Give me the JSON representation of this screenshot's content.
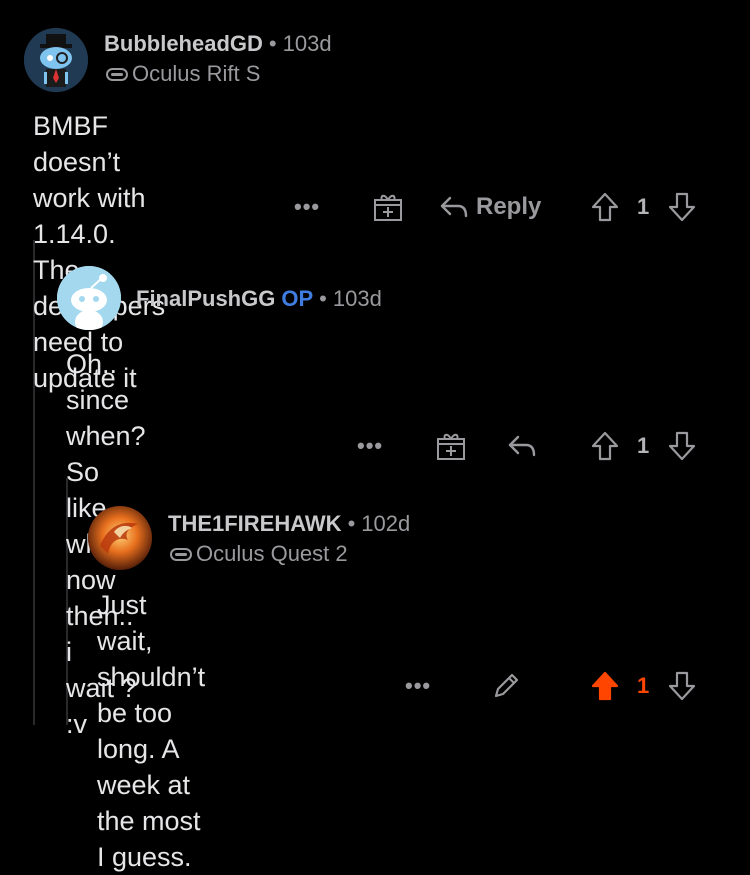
{
  "comments": [
    {
      "username": "BubbleheadGD",
      "age": "103d",
      "flair": "Oculus Rift S",
      "body_lines": [
        "BMBF doesn’t work with 1.14.0. The developers",
        "need to update it"
      ],
      "actions": {
        "more": "•••",
        "reply": "Reply",
        "score": "1",
        "upvoted": false
      }
    },
    {
      "username": "FinalPushGG",
      "op_badge": "OP",
      "age": "103d",
      "body_lines": [
        "Oh.. since when? So like what now then.. i",
        "wait ? :v"
      ],
      "actions": {
        "more": "•••",
        "score": "1",
        "upvoted": false
      }
    },
    {
      "username": "THE1FIREHAWK",
      "age": "102d",
      "flair": "Oculus Quest 2",
      "body_lines": [
        "Just wait, shouldn’t be too long. A week at",
        "the most I guess."
      ],
      "actions": {
        "more": "•••",
        "score": "1",
        "upvoted": true
      }
    }
  ],
  "meta": {
    "separator": "•"
  },
  "colors": {
    "background": "#000000",
    "op": "#3f7de0",
    "upvote": "#ff4500",
    "muted": "#9a9a9e"
  },
  "icons": {
    "award": "gift-plus-icon",
    "reply": "reply-arrow-icon",
    "upvote": "upvote-icon",
    "downvote": "downvote-icon",
    "edit": "pencil-icon"
  }
}
